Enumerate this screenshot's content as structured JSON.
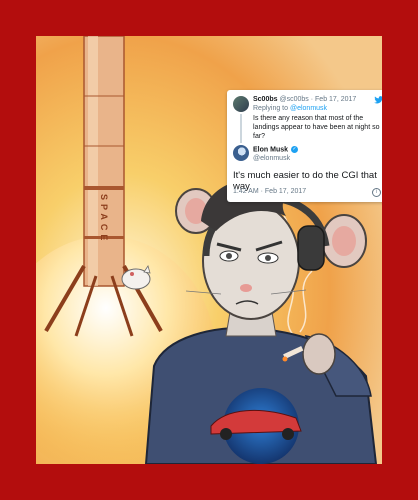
{
  "tweet": {
    "reply": {
      "display_name": "Sc00bs",
      "handle": "@sc00bs",
      "date": "Feb 17, 2017",
      "replying_prefix": "Replying to",
      "replying_handle": "@elonmusk",
      "text": "Is there any reason that most of the landings appear to have been at night so far?"
    },
    "main": {
      "display_name": "Elon Musk",
      "handle": "@elonmusk",
      "text": "It's much easier to do the CGI that way",
      "timestamp": "1:42 AM · Feb 17, 2017"
    },
    "icons": {
      "bird": "twitter-bird-icon",
      "verified": "verified-badge-icon",
      "info": "info-icon"
    }
  },
  "artwork": {
    "rocket_text": "SPACE",
    "colors": {
      "border": "#b30d0d",
      "glow": "#f7b54a",
      "shirt": "#3f4f72",
      "car": "#d33a3a"
    }
  }
}
